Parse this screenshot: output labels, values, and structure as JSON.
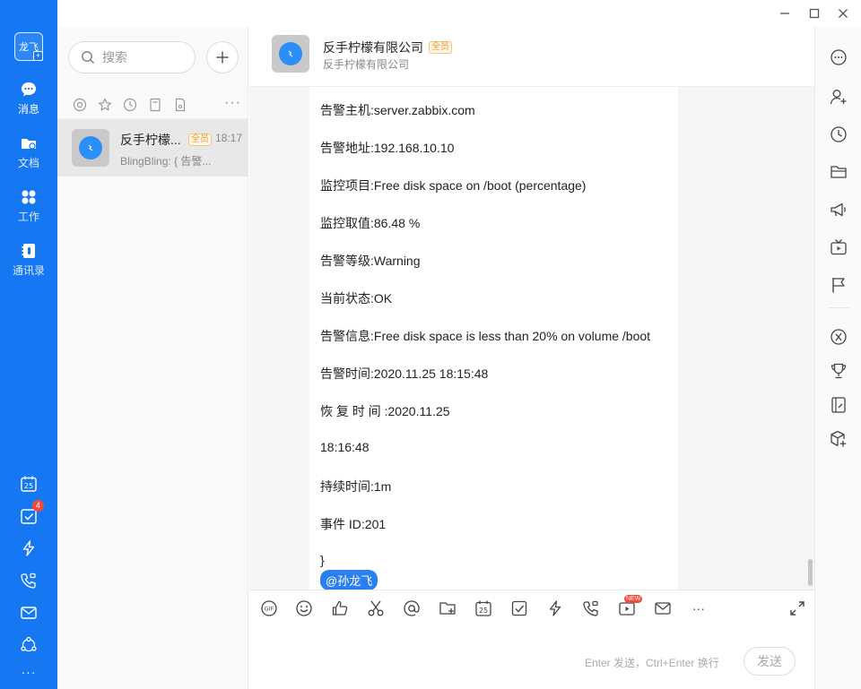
{
  "window": {
    "minimize": "—",
    "maximize": "□",
    "close": "✕"
  },
  "nav": {
    "avatar_text": "龙飞",
    "avatar_plus": "+",
    "items": [
      {
        "label": "消息",
        "icon": "chat-icon",
        "active": true
      },
      {
        "label": "文档",
        "icon": "folder-icon"
      },
      {
        "label": "工作",
        "icon": "grid-icon"
      },
      {
        "label": "通讯录",
        "icon": "contacts-icon"
      }
    ],
    "bottom": [
      {
        "icon": "calendar-icon",
        "text": "25"
      },
      {
        "icon": "todo-icon",
        "badge": "4"
      },
      {
        "icon": "flash-icon"
      },
      {
        "icon": "phone-video-icon"
      },
      {
        "icon": "mail-icon"
      },
      {
        "icon": "org-icon"
      },
      {
        "icon": "more-icon",
        "text": "···"
      }
    ]
  },
  "conversations": {
    "search_placeholder": "搜索",
    "more": "···",
    "items": [
      {
        "name": "反手柠檬...",
        "tag": "全员",
        "time": "18:17",
        "preview": "BlingBling: { 告警..."
      }
    ]
  },
  "chat": {
    "title": "反手柠檬有限公司",
    "tag": "全员",
    "subtitle": "反手柠檬有限公司",
    "lines": [
      "告警主机:server.zabbix.com",
      "告警地址:192.168.10.10",
      "监控项目:Free disk space on /boot (percentage)",
      "监控取值:86.48 %",
      "告警等级:Warning",
      "当前状态:OK",
      "告警信息:Free disk space is less than 20% on volume /boot",
      "告警时间:2020.11.25 18:15:48",
      "恢 复 时 间 :2020.11.25",
      "18:16:48",
      "持续时间:1m",
      "事件 ID:201",
      "}"
    ],
    "mention": "@孙龙飞"
  },
  "toolbar": {
    "gif": "GIF",
    "calendar_day": "25",
    "new_badge": "NEW",
    "more": "···"
  },
  "input": {
    "hint": "Enter 发送，Ctrl+Enter 换行",
    "send_label": "发送"
  },
  "colors": {
    "primary": "#1677f2",
    "badge": "#f5483b",
    "tag": "#f29a2e"
  }
}
